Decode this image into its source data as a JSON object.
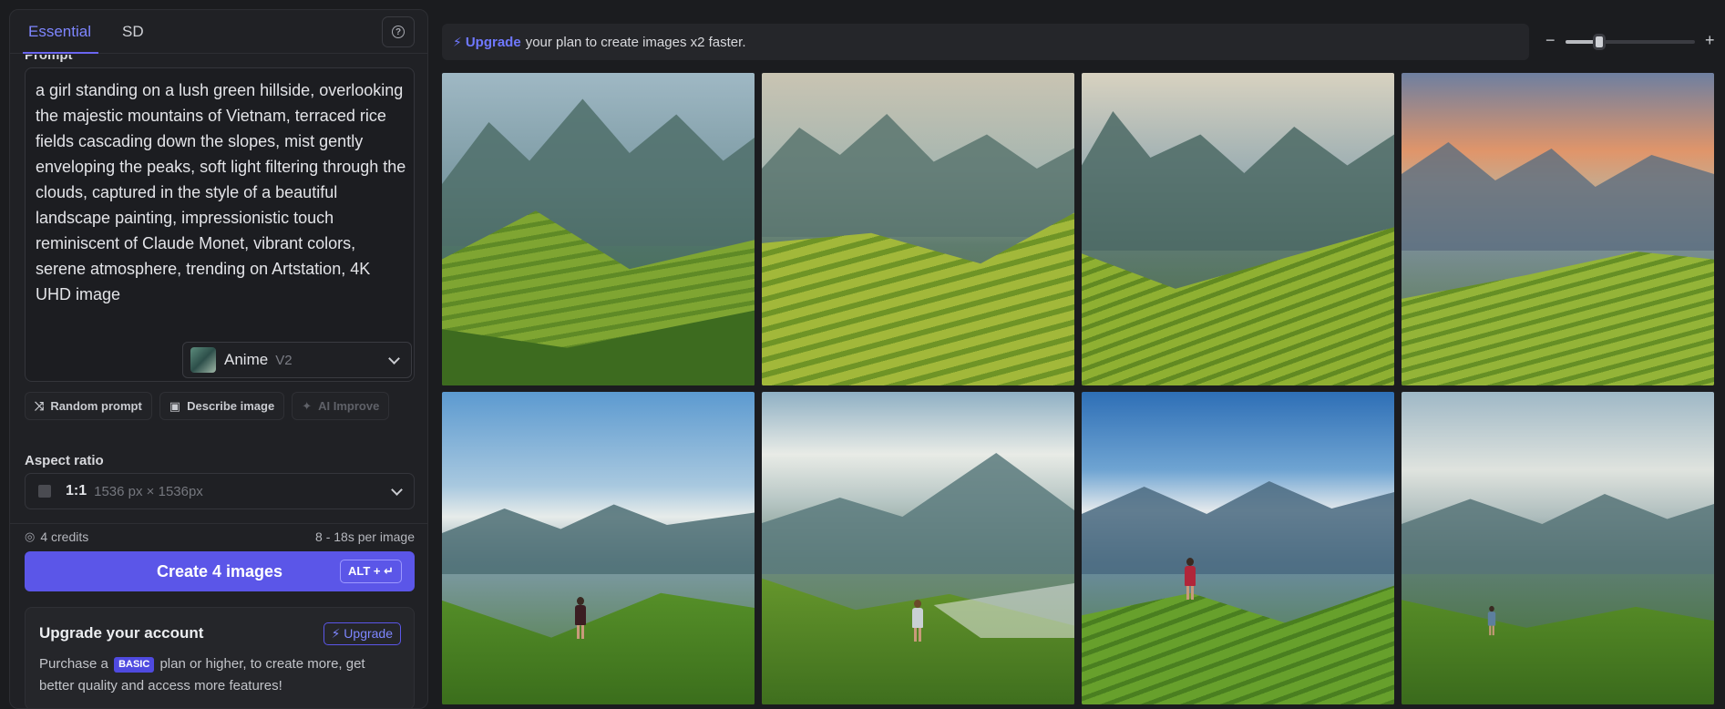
{
  "tabs": {
    "essential": "Essential",
    "sd": "SD"
  },
  "prompt": {
    "label": "Prompt",
    "text": "a girl standing on a lush green hillside, overlooking the majestic mountains of Vietnam, terraced rice fields cascading down the slopes, mist gently enveloping the peaks, soft light filtering through the clouds, captured in the style of a beautiful landscape painting, impressionistic touch reminiscent of Claude Monet, vibrant colors, serene atmosphere, trending on Artstation, 4K UHD image"
  },
  "model": {
    "name": "Anime",
    "version": "V2"
  },
  "actions": {
    "random": "Random prompt",
    "describe": "Describe image",
    "improve": "AI Improve"
  },
  "aspect": {
    "label": "Aspect ratio",
    "ratio": "1:1",
    "size": "1536 px × 1536px"
  },
  "credits": {
    "count": "4 credits",
    "timing": "8 - 18s per image"
  },
  "create": {
    "label": "Create 4 images",
    "shortcut": "ALT + ↵"
  },
  "upgrade_card": {
    "title": "Upgrade your account",
    "button": "Upgrade",
    "text_before": "Purchase a",
    "badge": "BASIC",
    "text_after": "plan or higher, to create more, get better quality and access more features!"
  },
  "banner": {
    "upgrade": "Upgrade",
    "text": "your plan to create images x2 faster."
  },
  "zoom": {
    "minus": "−",
    "plus": "+",
    "level": 0.26
  },
  "gallery": [
    {
      "alt": "Generated landscape 1"
    },
    {
      "alt": "Generated landscape 2"
    },
    {
      "alt": "Generated landscape 3"
    },
    {
      "alt": "Generated landscape 4"
    },
    {
      "alt": "Generated landscape 5"
    },
    {
      "alt": "Generated landscape 6"
    },
    {
      "alt": "Generated landscape 7"
    },
    {
      "alt": "Generated landscape 8"
    }
  ],
  "colors": {
    "accent": "#5b56e8",
    "accent_text": "#7e86ff",
    "background": "#1b1c1f",
    "panel": "#202125"
  }
}
